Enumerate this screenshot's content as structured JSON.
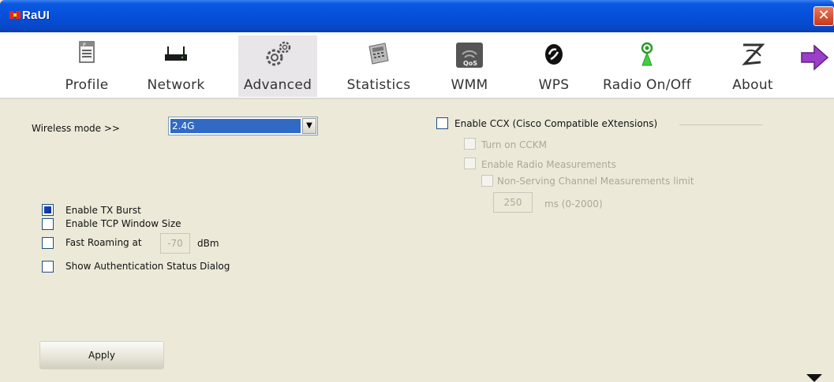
{
  "window": {
    "title": "RaUI",
    "close_symbol": "✕"
  },
  "toolbar": {
    "items": [
      {
        "label": "Profile",
        "icon": "profile-icon"
      },
      {
        "label": "Network",
        "icon": "network-icon"
      },
      {
        "label": "Advanced",
        "icon": "advanced-icon",
        "active": true
      },
      {
        "label": "Statistics",
        "icon": "statistics-icon"
      },
      {
        "label": "WMM",
        "icon": "wmm-icon",
        "badge": "QoS"
      },
      {
        "label": "WPS",
        "icon": "wps-icon"
      },
      {
        "label": "Radio On/Off",
        "icon": "radio-icon"
      },
      {
        "label": "About",
        "icon": "about-icon"
      }
    ],
    "next_icon": "arrow-right-icon"
  },
  "advanced": {
    "wireless_mode_label": "Wireless mode >>",
    "wireless_mode_value": "2.4G",
    "tx_burst_label": "Enable TX Burst",
    "tx_burst_checked": true,
    "tcp_window_label": "Enable TCP Window Size",
    "fast_roaming_label": "Fast Roaming at",
    "fast_roaming_value": "-70",
    "fast_roaming_unit": "dBm",
    "auth_status_label": "Show Authentication Status Dialog",
    "apply_label": "Apply"
  },
  "ccx": {
    "enable_label": "Enable CCX (Cisco Compatible eXtensions)",
    "cckm_label": "Turn on CCKM",
    "radio_meas_label": "Enable Radio Measurements",
    "non_serving_label": "Non-Serving Channel Measurements limit",
    "limit_value": "250",
    "limit_unit": "ms (0-2000)"
  },
  "colors": {
    "titlebar": "#0650dc",
    "selection": "#316ac5",
    "panel": "#ece9d8"
  }
}
